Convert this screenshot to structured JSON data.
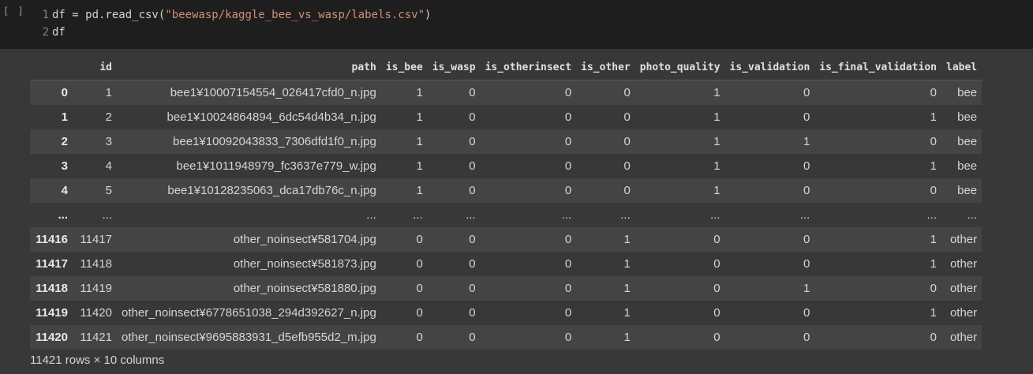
{
  "cell": {
    "run_indicator": "[ ]",
    "lines": [
      {
        "num": "1",
        "pre": "df = pd.read_csv(",
        "str": "\"beewasp/kaggle_bee_vs_wasp/labels.csv\"",
        "post": ")"
      },
      {
        "num": "2",
        "pre": "df",
        "str": "",
        "post": ""
      }
    ]
  },
  "table": {
    "index_header": "",
    "columns": [
      "id",
      "path",
      "is_bee",
      "is_wasp",
      "is_otherinsect",
      "is_other",
      "photo_quality",
      "is_validation",
      "is_final_validation",
      "label"
    ],
    "rows": [
      {
        "index": "0",
        "cells": [
          "1",
          "bee1¥10007154554_026417cfd0_n.jpg",
          "1",
          "0",
          "0",
          "0",
          "1",
          "0",
          "0",
          "bee"
        ]
      },
      {
        "index": "1",
        "cells": [
          "2",
          "bee1¥10024864894_6dc54d4b34_n.jpg",
          "1",
          "0",
          "0",
          "0",
          "1",
          "0",
          "1",
          "bee"
        ]
      },
      {
        "index": "2",
        "cells": [
          "3",
          "bee1¥10092043833_7306dfd1f0_n.jpg",
          "1",
          "0",
          "0",
          "0",
          "1",
          "1",
          "0",
          "bee"
        ]
      },
      {
        "index": "3",
        "cells": [
          "4",
          "bee1¥1011948979_fc3637e779_w.jpg",
          "1",
          "0",
          "0",
          "0",
          "1",
          "0",
          "1",
          "bee"
        ]
      },
      {
        "index": "4",
        "cells": [
          "5",
          "bee1¥10128235063_dca17db76c_n.jpg",
          "1",
          "0",
          "0",
          "0",
          "1",
          "0",
          "0",
          "bee"
        ]
      },
      {
        "index": "...",
        "cells": [
          "...",
          "...",
          "...",
          "...",
          "...",
          "...",
          "...",
          "...",
          "...",
          "..."
        ]
      },
      {
        "index": "11416",
        "cells": [
          "11417",
          "other_noinsect¥581704.jpg",
          "0",
          "0",
          "0",
          "1",
          "0",
          "0",
          "1",
          "other"
        ]
      },
      {
        "index": "11417",
        "cells": [
          "11418",
          "other_noinsect¥581873.jpg",
          "0",
          "0",
          "0",
          "1",
          "0",
          "0",
          "1",
          "other"
        ]
      },
      {
        "index": "11418",
        "cells": [
          "11419",
          "other_noinsect¥581880.jpg",
          "0",
          "0",
          "0",
          "1",
          "0",
          "1",
          "0",
          "other"
        ]
      },
      {
        "index": "11419",
        "cells": [
          "11420",
          "other_noinsect¥6778651038_294d392627_n.jpg",
          "0",
          "0",
          "0",
          "1",
          "0",
          "0",
          "1",
          "other"
        ]
      },
      {
        "index": "11420",
        "cells": [
          "11421",
          "other_noinsect¥9695883931_d5efb955d2_m.jpg",
          "0",
          "0",
          "0",
          "1",
          "0",
          "0",
          "0",
          "other"
        ]
      }
    ]
  },
  "footer": "11421 rows × 10 columns"
}
